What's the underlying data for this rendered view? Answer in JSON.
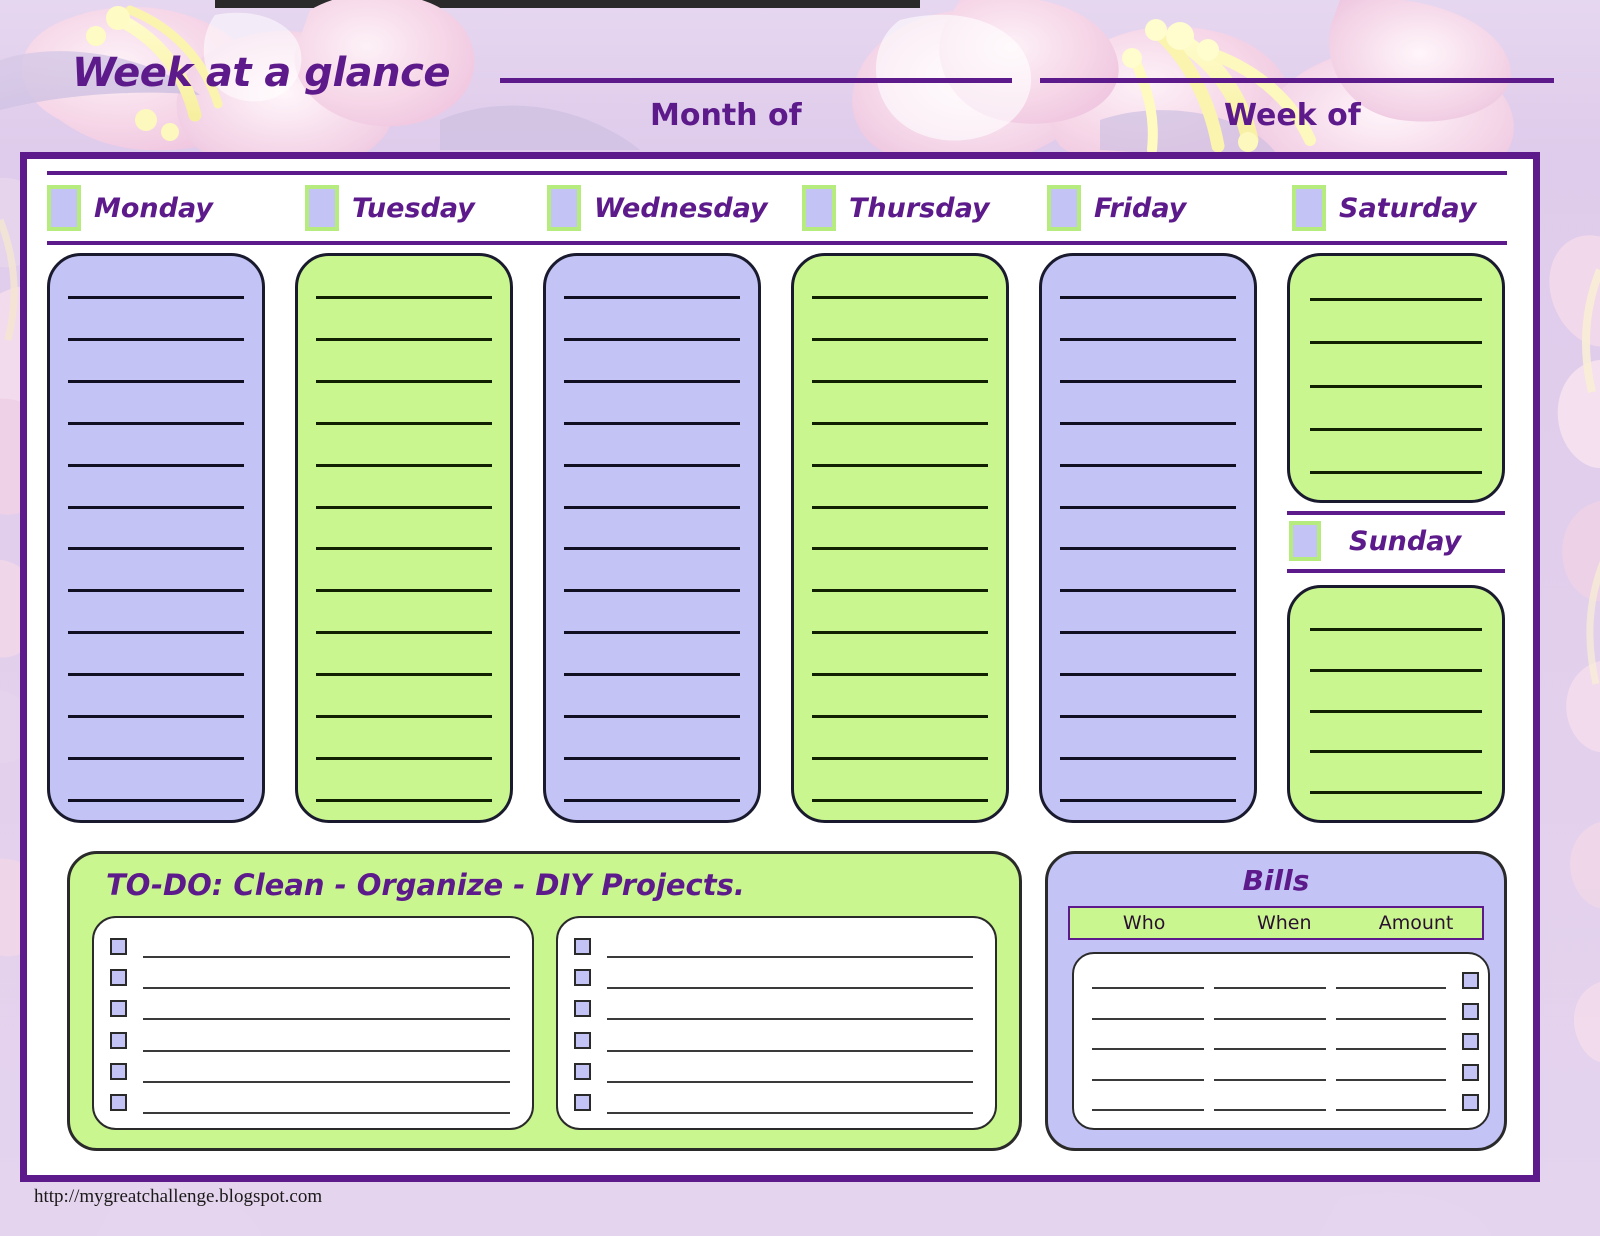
{
  "header": {
    "title": "Week at a glance",
    "month_label": "Month  of",
    "week_label": "Week of"
  },
  "days": [
    {
      "name": "Monday",
      "color": "#C3C3F5",
      "lines": 13
    },
    {
      "name": "Tuesday",
      "color": "#C9F68F",
      "lines": 13
    },
    {
      "name": "Wednesday",
      "color": "#C3C3F5",
      "lines": 13
    },
    {
      "name": "Thursday",
      "color": "#C9F68F",
      "lines": 13
    },
    {
      "name": "Friday",
      "color": "#C3C3F5",
      "lines": 13
    },
    {
      "name": "Saturday",
      "color": "#C9F68F",
      "lines": 5
    },
    {
      "name": "Sunday",
      "color": "#C9F68F",
      "lines": 5
    }
  ],
  "todo": {
    "title": "TO-DO:  Clean - Organize - DIY Projects.",
    "rows_per_card": 6,
    "cards": 2
  },
  "bills": {
    "title": "Bills",
    "columns": [
      "Who",
      "When",
      "Amount"
    ],
    "rows": 5
  },
  "footer": {
    "url": "http://mygreatchallenge.blogspot.com"
  },
  "colors": {
    "purple": "#5D1A8B",
    "lavender": "#C3C3F5",
    "green": "#C9F68F",
    "page_bg": "#E3D2EC",
    "card_bg": "#FFFFFF"
  }
}
